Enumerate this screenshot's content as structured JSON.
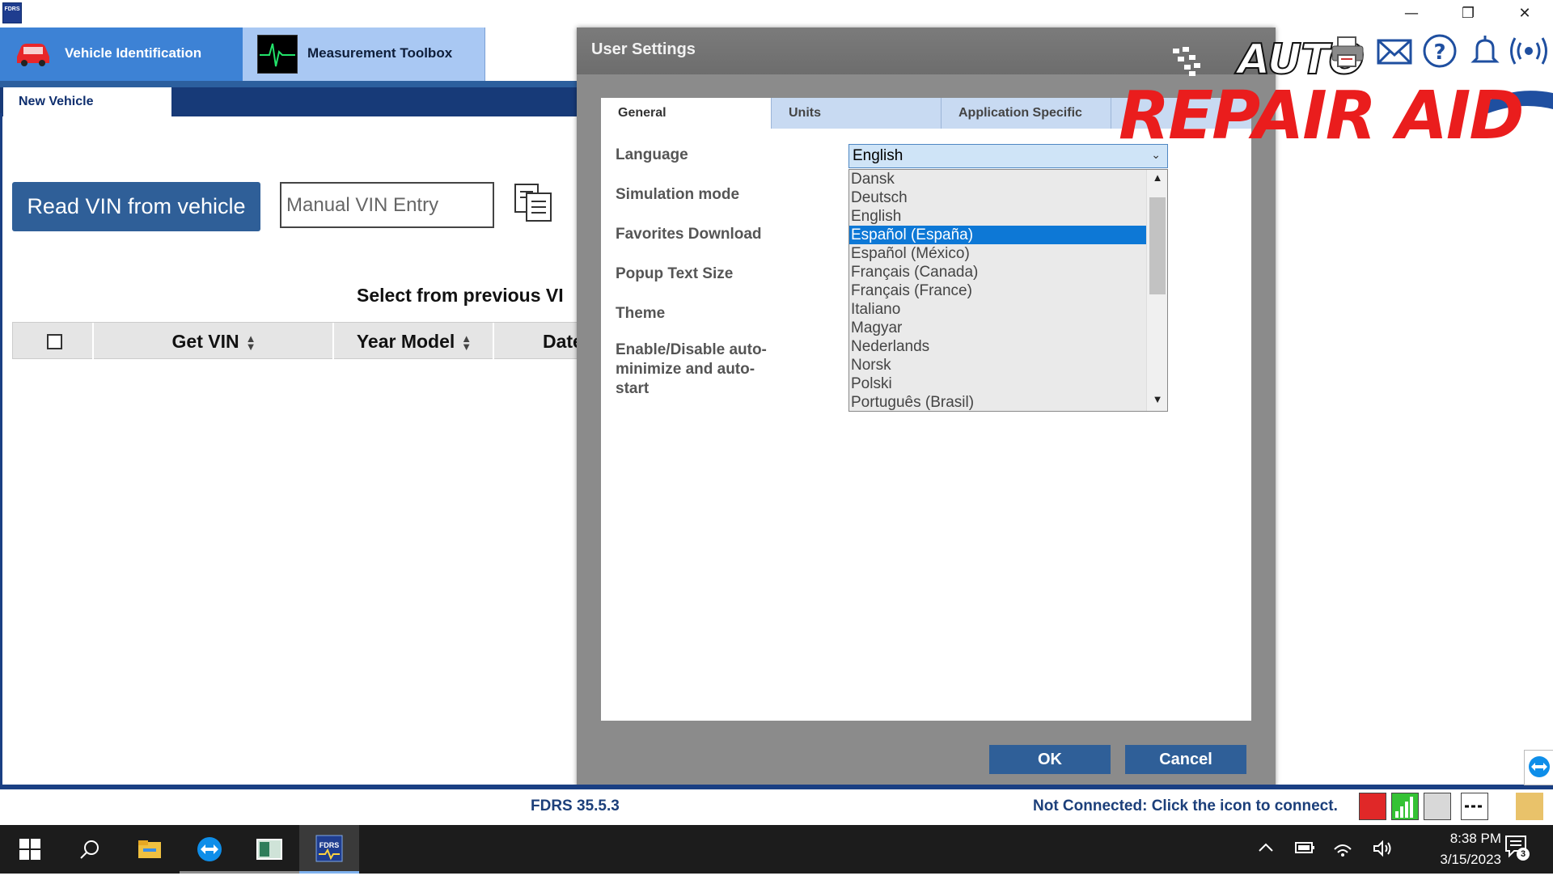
{
  "window": {
    "app_logo_text": "FDRS",
    "minimize": "—",
    "restore": "❐",
    "close": "✕"
  },
  "modules": [
    {
      "label": "Vehicle Identification",
      "icon": "car-icon"
    },
    {
      "label": "Measurement Toolbox",
      "icon": "oscilloscope-icon"
    }
  ],
  "subtabs": [
    {
      "label": "New Vehicle"
    }
  ],
  "vehicle_panel": {
    "read_vin_button": "Read VIN from vehicle",
    "manual_vin_placeholder": "Manual VIN Entry",
    "select_previous_label": "Select from previous VI",
    "grid_headers": [
      "Get VIN",
      "Year Model",
      "Date"
    ]
  },
  "dialog": {
    "title": "User Settings",
    "tabs": [
      "General",
      "Units",
      "Application Specific"
    ],
    "settings": [
      "Language",
      "Simulation mode",
      "Favorites Download",
      "Popup Text Size",
      "Theme",
      "Enable/Disable auto-minimize and auto-start"
    ],
    "language": {
      "selected": "English",
      "highlighted": "Español (España)",
      "options": [
        "Dansk",
        "Deutsch",
        "English",
        "Español (España)",
        "Español (México)",
        "Français (Canada)",
        "Français (France)",
        "Italiano",
        "Magyar",
        "Nederlands",
        "Norsk",
        "Polski",
        "Português (Brasil)"
      ]
    },
    "ok_button": "OK",
    "cancel_button": "Cancel"
  },
  "branding": {
    "auto": "AUTO",
    "repair_aid": "REPAIR AID"
  },
  "toolbar_icons": [
    "printer-icon",
    "mail-icon",
    "help-icon",
    "notification-bell-icon",
    "wireless-broadcast-icon"
  ],
  "status": {
    "version": "FDRS 35.5.3",
    "connection": "Not Connected: Click the icon to connect."
  },
  "taskbar": {
    "time": "8:38 PM",
    "date": "3/15/2023",
    "notification_count": "3"
  },
  "colors": {
    "brand_blue": "#2f5f98",
    "tab_active": "#3d82d5",
    "selection": "#0d78d6",
    "logo_red": "#ea1d1d"
  }
}
